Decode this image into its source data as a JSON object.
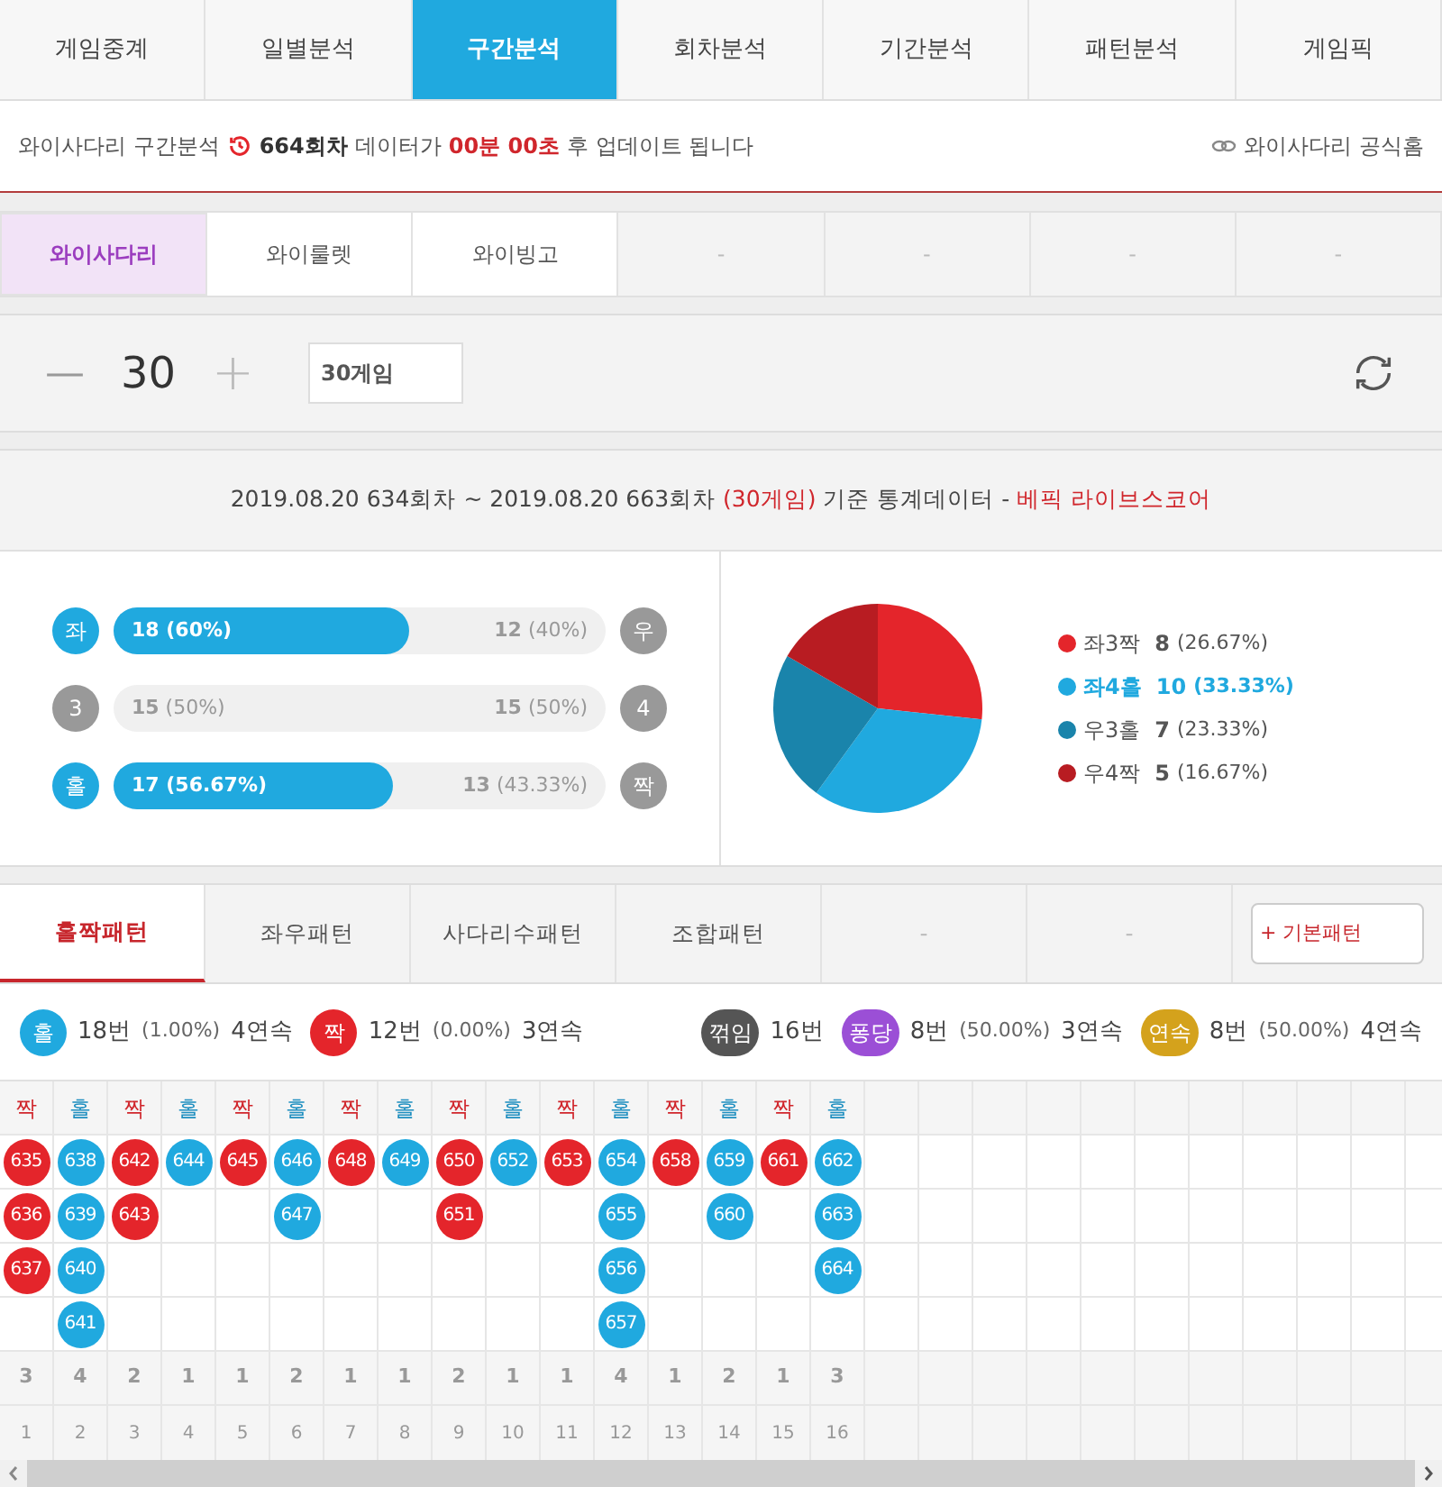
{
  "nav_tabs": [
    {
      "label": "게임중계",
      "selected": false
    },
    {
      "label": "일별분석",
      "selected": false
    },
    {
      "label": "구간분석",
      "selected": true
    },
    {
      "label": "회차분석",
      "selected": false
    },
    {
      "label": "기간분석",
      "selected": false
    },
    {
      "label": "패턴분석",
      "selected": false
    },
    {
      "label": "게임픽",
      "selected": false
    }
  ],
  "notice": {
    "prefix": "와이사다리 구간분석",
    "round": "664회차",
    "middle": "데이터가",
    "timer": "00분 00초",
    "suffix": "후 업데이트 됩니다",
    "link": "와이사다리 공식홈"
  },
  "game_tabs": [
    {
      "label": "와이사다리",
      "selected": true,
      "disabled": false
    },
    {
      "label": "와이룰렛",
      "selected": false,
      "disabled": false
    },
    {
      "label": "와이빙고",
      "selected": false,
      "disabled": false
    },
    {
      "label": "-",
      "selected": false,
      "disabled": true
    },
    {
      "label": "-",
      "selected": false,
      "disabled": true
    },
    {
      "label": "-",
      "selected": false,
      "disabled": true
    },
    {
      "label": "-",
      "selected": false,
      "disabled": true
    }
  ],
  "counter": {
    "minus": "—",
    "value": "30",
    "plus": "+",
    "games_field": "30게임"
  },
  "summary": {
    "range": "2019.08.20 634회차 ~ 2019.08.20 663회차",
    "games": "(30게임)",
    "basis": "기준 통계데이터 -",
    "source": "베픽 라이브스코어"
  },
  "bars": [
    {
      "left_badge": "좌",
      "left_active": true,
      "left_value": "**18** (60%)",
      "right_value": "**12** (40%)",
      "right_badge": "우",
      "level": 0.6
    },
    {
      "left_badge": "3",
      "left_active": false,
      "left_value": "**15** (50%)",
      "right_value": "**15** (50%)",
      "right_badge": "4"
    },
    {
      "left_badge": "홀",
      "left_active": true,
      "left_value": "**17** (56.67%)",
      "right_value": "**13** (43.33%)",
      "right_badge": "짝",
      "level": 0.5667
    }
  ],
  "chart_data": {
    "type": "pie",
    "values": [
      26.67,
      33.33,
      23.33,
      16.67
    ],
    "colors": [
      "#e4252b",
      "#20a9df",
      "#1a84ab",
      "#b81c22"
    ]
  },
  "legend": [
    {
      "label": "좌3짝",
      "value": "8",
      "percent": "(26.67%)",
      "color": "#e4252b",
      "highlighted": false
    },
    {
      "label": "좌4홀",
      "value": "10",
      "percent": "(33.33%)",
      "color": "#20a9df",
      "highlighted": true
    },
    {
      "label": "우3홀",
      "value": "7",
      "percent": "(23.33%)",
      "color": "#1a84ab",
      "highlighted": false
    },
    {
      "label": "우4짝",
      "value": "5",
      "percent": "(16.67%)",
      "color": "#b81c22",
      "highlighted": false
    }
  ],
  "pattern_tabs": [
    {
      "label": "홀짝패턴",
      "selected": true,
      "disabled": false
    },
    {
      "label": "좌우패턴",
      "selected": false,
      "disabled": false
    },
    {
      "label": "사다리수패턴",
      "selected": false,
      "disabled": false
    },
    {
      "label": "조합패턴",
      "selected": false,
      "disabled": false
    },
    {
      "label": "-",
      "selected": false,
      "disabled": true
    },
    {
      "label": "-",
      "selected": false,
      "disabled": true
    }
  ],
  "pattern_button": "+ 기본패턴",
  "stats_left": [
    {
      "badge": "홀",
      "color": "#20a9df",
      "count": "18번",
      "percent": "(1.00%)",
      "streak": "4연속"
    },
    {
      "badge": "짝",
      "color": "#e4252b",
      "count": "12번",
      "percent": "(0.00%)",
      "streak": "3연속"
    }
  ],
  "stats_right": [
    {
      "badge": "꺾임",
      "color": "#555555",
      "count": "16번"
    },
    {
      "badge": "퐁당",
      "color": "#9b4fd6",
      "count": "8번",
      "percent": "(50.00%)",
      "streak": "3연속"
    },
    {
      "badge": "연속",
      "color": "#d4a21c",
      "count": "8번",
      "percent": "(50.00%)",
      "streak": "4연속"
    }
  ],
  "grid_columns": [
    {
      "header": "짝",
      "kind": "even",
      "balls": [
        "635",
        "636",
        "637"
      ],
      "count": "3",
      "index": "1"
    },
    {
      "header": "홀",
      "kind": "odd",
      "balls": [
        "638",
        "639",
        "640",
        "641"
      ],
      "count": "4",
      "index": "2"
    },
    {
      "header": "짝",
      "kind": "even",
      "balls": [
        "642",
        "643"
      ],
      "count": "2",
      "index": "3"
    },
    {
      "header": "홀",
      "kind": "odd",
      "balls": [
        "644"
      ],
      "count": "1",
      "index": "4"
    },
    {
      "header": "짝",
      "kind": "even",
      "balls": [
        "645"
      ],
      "count": "1",
      "index": "5"
    },
    {
      "header": "홀",
      "kind": "odd",
      "balls": [
        "646",
        "647"
      ],
      "count": "2",
      "index": "6"
    },
    {
      "header": "짝",
      "kind": "even",
      "balls": [
        "648"
      ],
      "count": "1",
      "index": "7"
    },
    {
      "header": "홀",
      "kind": "odd",
      "balls": [
        "649"
      ],
      "count": "1",
      "index": "8"
    },
    {
      "header": "짝",
      "kind": "even",
      "balls": [
        "650",
        "651"
      ],
      "count": "2",
      "index": "9"
    },
    {
      "header": "홀",
      "kind": "odd",
      "balls": [
        "652"
      ],
      "count": "1",
      "index": "10"
    },
    {
      "header": "짝",
      "kind": "even",
      "balls": [
        "653"
      ],
      "count": "1",
      "index": "11"
    },
    {
      "header": "홀",
      "kind": "odd",
      "balls": [
        "654",
        "655",
        "656",
        "657"
      ],
      "count": "4",
      "index": "12"
    },
    {
      "header": "짝",
      "kind": "even",
      "balls": [
        "658"
      ],
      "count": "1",
      "index": "13"
    },
    {
      "header": "홀",
      "kind": "odd",
      "balls": [
        "659",
        "660"
      ],
      "count": "2",
      "index": "14"
    },
    {
      "header": "짝",
      "kind": "even",
      "balls": [
        "661"
      ],
      "count": "1",
      "index": "15"
    },
    {
      "header": "홀",
      "kind": "odd",
      "balls": [
        "662",
        "663",
        "664"
      ],
      "count": "3",
      "index": "16"
    }
  ]
}
